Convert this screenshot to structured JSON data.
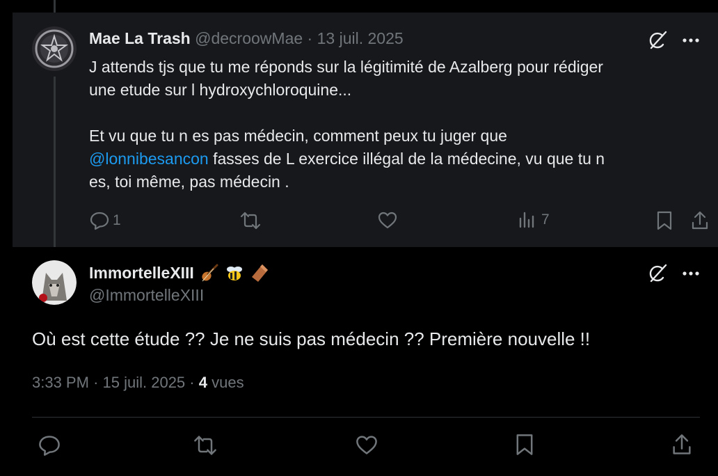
{
  "parent_post": {
    "display_name": "Mae La Trash",
    "handle": "@decroowMae",
    "separator": "·",
    "date": "13 juil. 2025",
    "text_line1": "J attends tjs que tu me réponds sur la légitimité de Azalberg pour rédiger",
    "text_line2": "une etude sur l hydroxychloroquine...",
    "text_line3": "Et vu que tu n es pas médecin, comment peux tu juger que",
    "mention": "@lonnibesancon",
    "text_line4_rest": " fasses de L exercice illégal de la médecine, vu que tu n",
    "text_line5": "es, toi même, pas médecin .",
    "reply_count": "1",
    "views_count": "7"
  },
  "main_post": {
    "display_name": "ImmortelleXIII",
    "emojis": [
      "violin",
      "bee",
      "coffin"
    ],
    "handle": "@ImmortelleXIII",
    "text": "Où est cette étude ?? Je ne suis pas médecin ?? Première nouvelle !!",
    "time": "3:33 PM",
    "separator1": "·",
    "date": "15 juil. 2025",
    "separator2": "·",
    "views_count": "4",
    "views_label": "vues"
  },
  "colors": {
    "background": "#000000",
    "parent_background": "#16181c",
    "text": "#e7e9ea",
    "muted": "#71767b",
    "link": "#1d9bf0",
    "divider": "#2f3336"
  }
}
